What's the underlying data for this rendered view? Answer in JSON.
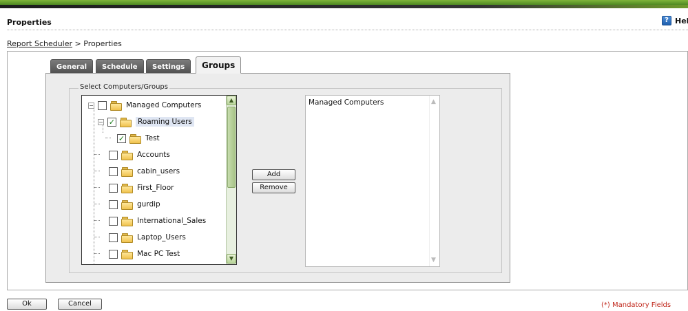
{
  "header": {
    "title": "Properties",
    "help_label": "Help",
    "help_icon": "help-icon"
  },
  "breadcrumb": {
    "link": "Report Scheduler",
    "separator": ">",
    "current": "Properties"
  },
  "tabs": [
    {
      "label": "General",
      "active": false
    },
    {
      "label": "Schedule",
      "active": false
    },
    {
      "label": "Settings",
      "active": false
    },
    {
      "label": "Groups",
      "active": true
    }
  ],
  "groups": {
    "legend": "Select Computers/Groups",
    "tree": [
      {
        "label": "Managed Computers",
        "checked": false,
        "expander": "minus"
      },
      {
        "label": "Roaming Users",
        "checked": true,
        "expander": "minus",
        "highlighted": true
      },
      {
        "label": "Test",
        "checked": true
      },
      {
        "label": "Accounts",
        "checked": false
      },
      {
        "label": "cabin_users",
        "checked": false
      },
      {
        "label": "First_Floor",
        "checked": false
      },
      {
        "label": "gurdip",
        "checked": false
      },
      {
        "label": "International_Sales",
        "checked": false
      },
      {
        "label": "Laptop_Users",
        "checked": false
      },
      {
        "label": "Mac PC Test",
        "checked": false
      }
    ],
    "add_label": "Add",
    "remove_label": "Remove",
    "selected": [
      "Managed Computers"
    ]
  },
  "footer": {
    "ok_label": "Ok",
    "cancel_label": "Cancel",
    "mandatory_note": "(*) Mandatory Fields"
  },
  "colors": {
    "accent_green": "#6e9a2b",
    "tab_inactive": "#5f5f5f",
    "mandatory_red": "#c0281c",
    "selection_highlight": "#dfe6f3"
  }
}
